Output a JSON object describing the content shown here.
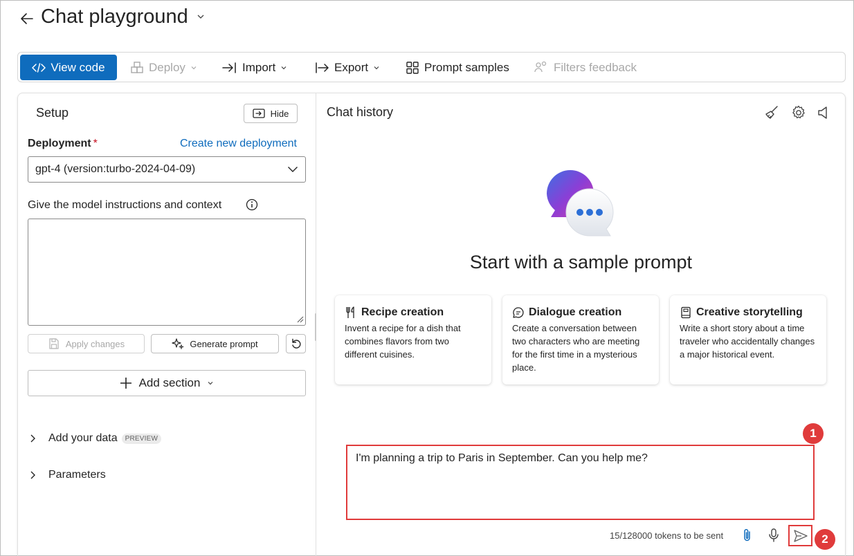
{
  "header": {
    "title": "Chat playground"
  },
  "toolbar": {
    "view_code": "View code",
    "deploy": "Deploy",
    "import": "Import",
    "export": "Export",
    "prompt_samples": "Prompt samples",
    "filters_feedback": "Filters feedback"
  },
  "setup": {
    "title": "Setup",
    "hide_label": "Hide",
    "deployment_label": "Deployment",
    "required_mark": "*",
    "create_link": "Create new deployment",
    "deployment_value": "gpt-4 (version:turbo-2024-04-09)",
    "instructions_label": "Give the model instructions and context",
    "instructions_value": "",
    "apply_label": "Apply changes",
    "generate_label": "Generate prompt",
    "add_section_label": "Add section",
    "add_data_label": "Add your data",
    "preview_badge": "PREVIEW",
    "parameters_label": "Parameters"
  },
  "chat": {
    "title": "Chat history",
    "heading": "Start with a sample prompt",
    "cards": [
      {
        "title": "Recipe creation",
        "body": "Invent a recipe for a dish that combines flavors from two different cuisines.",
        "icon": "utensils-icon"
      },
      {
        "title": "Dialogue creation",
        "body": "Create a conversation between two characters who are meeting for the first time in a mysterious place.",
        "icon": "chat-bubble-icon"
      },
      {
        "title": "Creative storytelling",
        "body": "Write a short story about a time traveler who accidentally changes a major historical event.",
        "icon": "book-icon"
      }
    ],
    "input_value": "I'm planning a trip to Paris in September. Can you help me?",
    "token_text": "15/128000 tokens to be sent"
  },
  "annotations": {
    "marker1": "1",
    "marker2": "2"
  },
  "colors": {
    "accent": "#0f6cbd",
    "highlight": "#e03b3b"
  }
}
